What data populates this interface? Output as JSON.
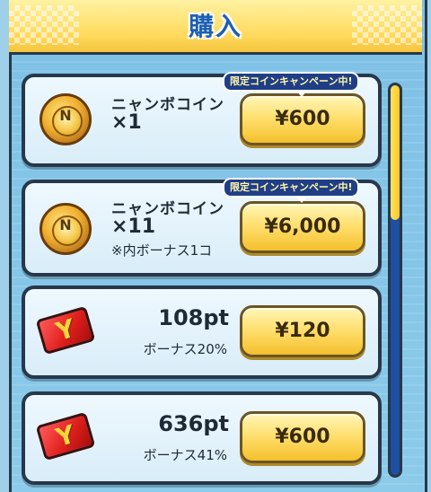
{
  "header": {
    "title": "購入"
  },
  "items": [
    {
      "type": "coin",
      "name": "ニャンボコイン",
      "quantity": "×1",
      "note": "",
      "price": "¥600",
      "badge": "限定コインキャンペーン中!",
      "icon": "nyanbo-coin-icon"
    },
    {
      "type": "coin",
      "name": "ニャンボコイン",
      "quantity": "×11",
      "note": "※内ボーナス1コ",
      "price": "¥6,000",
      "badge": "限定コインキャンペーン中!",
      "icon": "nyanbo-coin-icon"
    },
    {
      "type": "points",
      "points": "108pt",
      "bonus": "ボーナス20%",
      "price": "¥120",
      "icon": "y-card-icon"
    },
    {
      "type": "points",
      "points": "636pt",
      "bonus": "ボーナス41%",
      "price": "¥600",
      "icon": "y-card-icon"
    }
  ],
  "coin_label": "N",
  "card_label": "Y",
  "colors": {
    "title": "#1d5fb0",
    "button": "#ffe070",
    "badge_bg": "#1f3e86",
    "scroll_thumb": "#f7c82a",
    "scroll_track": "#1f4fa0"
  }
}
